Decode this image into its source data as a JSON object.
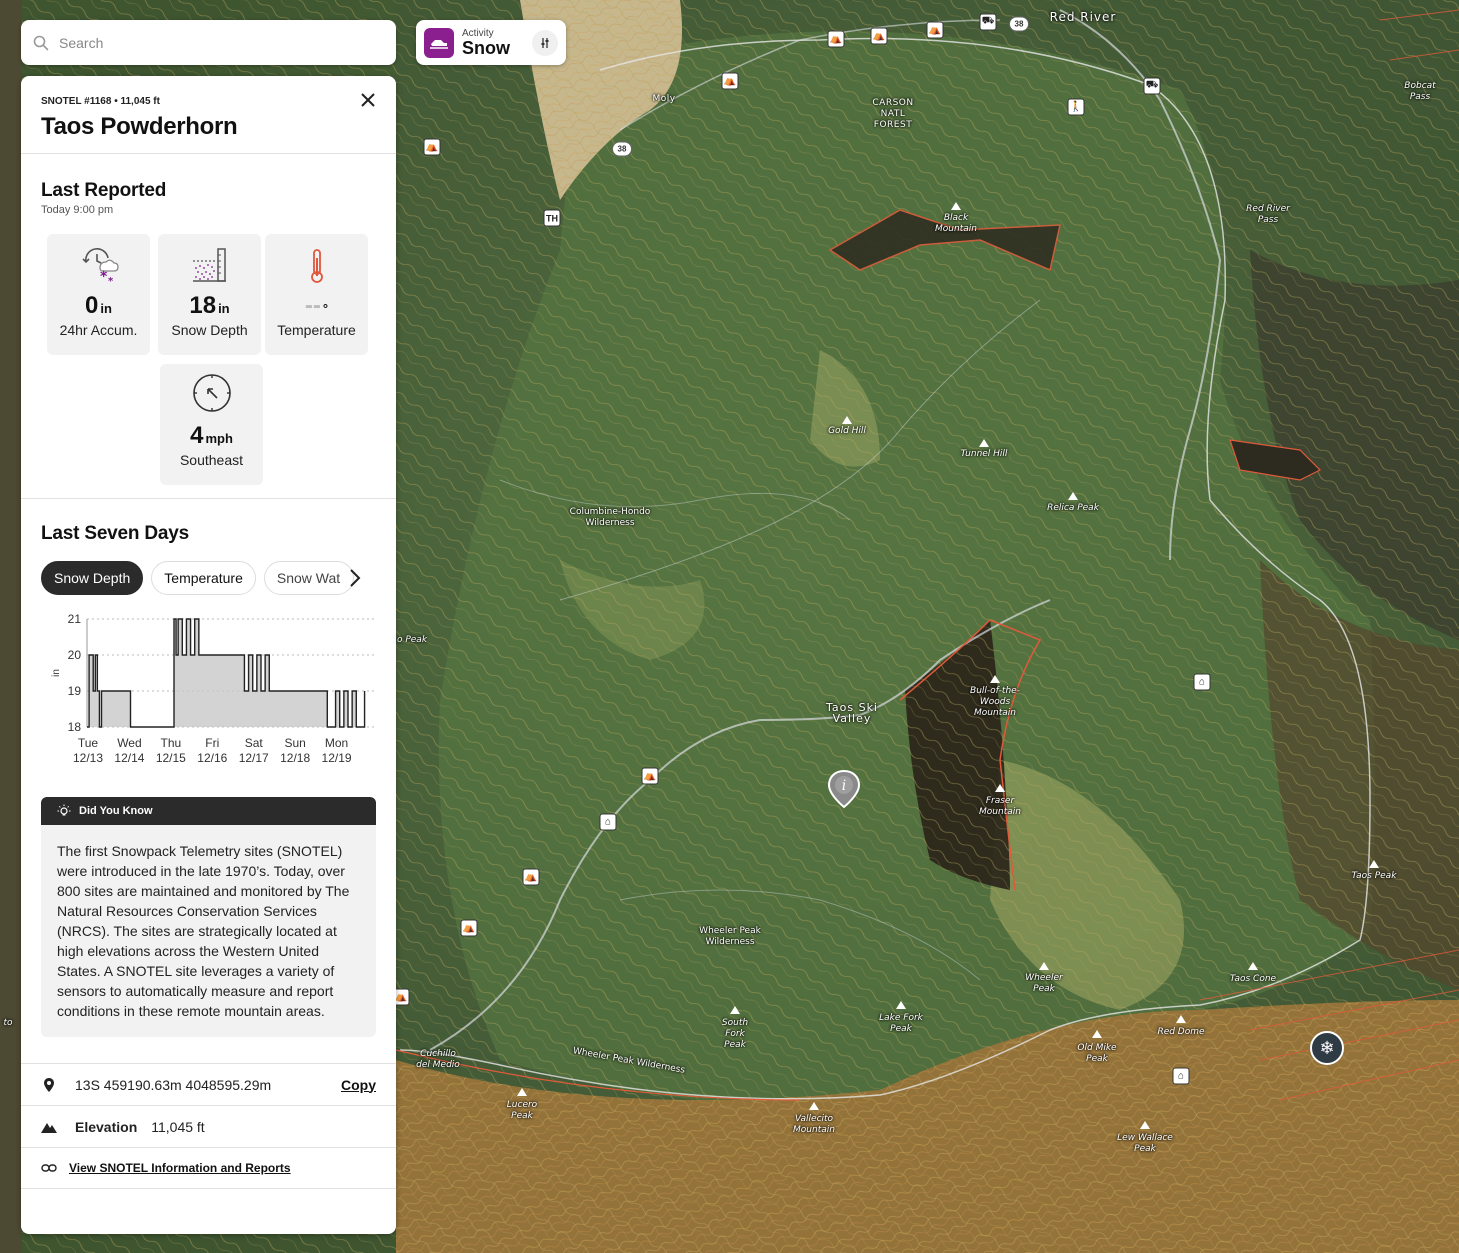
{
  "search": {
    "placeholder": "Search"
  },
  "activity": {
    "kicker": "Activity",
    "name": "Snow"
  },
  "panel": {
    "meta": "SNOTEL #1168 • 11,045 ft",
    "title": "Taos Powderhorn",
    "last_reported": {
      "heading": "Last Reported",
      "time": "Today 9:00 pm",
      "tiles": [
        {
          "icon": "snowfall-accumulation-icon",
          "value": "0",
          "unit": "in",
          "label": "24hr Accum."
        },
        {
          "icon": "snow-depth-gauge-icon",
          "value": "18",
          "unit": "in",
          "label": "Snow Depth"
        },
        {
          "icon": "thermometer-icon",
          "value": "--",
          "unit": "°",
          "label": "Temperature"
        },
        {
          "icon": "wind-compass-icon",
          "value": "4",
          "unit": "mph",
          "label": "Southeast"
        }
      ]
    },
    "seven_days": {
      "heading": "Last Seven Days",
      "tabs": [
        "Snow Depth",
        "Temperature",
        "Snow Wat"
      ]
    },
    "did_you_know": {
      "heading": "Did You Know",
      "body": "The first Snowpack Telemetry sites (SNOTEL) were introduced in the late 1970’s. Today, over 800 sites are maintained and monitored by The Natural Resources Conservation Services (NRCS). The sites are strategically located at high elevations across the Western United States. A SNOTEL site leverages a variety of sensors to automatically measure and report conditions in these remote mountain areas."
    },
    "coords": "13S 459190.63m 4048595.29m",
    "copy_label": "Copy",
    "elevation_label": "Elevation",
    "elevation_value": "11,045 ft",
    "report_link": "View SNOTEL Information and Reports"
  },
  "chart_data": {
    "type": "line",
    "ylabel": "in",
    "ylim": [
      18,
      21
    ],
    "yticks": [
      18,
      19,
      20,
      21
    ],
    "xticks": [
      {
        "day": "Tue",
        "date": "12/13"
      },
      {
        "day": "Wed",
        "date": "12/14"
      },
      {
        "day": "Thu",
        "date": "12/15"
      },
      {
        "day": "Fri",
        "date": "12/16"
      },
      {
        "day": "Sat",
        "date": "12/17"
      },
      {
        "day": "Sun",
        "date": "12/18"
      },
      {
        "day": "Mon",
        "date": "12/19"
      }
    ],
    "series": [
      {
        "fill": true,
        "x": [
          0,
          0.05,
          0.1,
          0.15,
          0.2,
          0.25,
          0.3,
          0.35,
          0.4,
          0.5,
          0.6,
          0.7,
          0.8,
          0.9,
          1.0,
          1.05,
          1.1,
          1.2,
          1.3,
          1.4,
          1.5,
          1.6,
          1.7,
          1.8,
          1.9,
          2.0,
          2.1,
          2.15,
          2.2,
          2.3,
          2.4,
          2.5,
          2.6,
          2.7,
          2.8,
          2.9,
          3.0,
          3.1,
          3.2,
          3.3,
          3.4,
          3.5,
          3.6,
          3.7,
          3.8,
          3.9,
          4.0,
          4.1,
          4.2,
          4.3,
          4.4,
          4.5,
          4.6,
          4.7,
          4.8,
          4.9,
          5.0,
          5.1,
          5.2,
          5.3,
          5.4,
          5.5,
          5.6,
          5.7,
          5.8,
          5.9,
          6.0,
          6.1,
          6.2,
          6.3,
          6.4,
          6.5,
          6.6,
          6.7
        ],
        "y": [
          18,
          20,
          20,
          19,
          20,
          19,
          18,
          19,
          19,
          19,
          19,
          19,
          19,
          19,
          19,
          18,
          18,
          18,
          18,
          18,
          18,
          18,
          18,
          18,
          18,
          18,
          21,
          20,
          21,
          20,
          21,
          20,
          21,
          20,
          20,
          20,
          20,
          20,
          20,
          20,
          20,
          20,
          20,
          20,
          19,
          20,
          19,
          20,
          19,
          20,
          19,
          19,
          19,
          19,
          19,
          19,
          19,
          19,
          19,
          19,
          19,
          19,
          19,
          19,
          18,
          18,
          19,
          18,
          19,
          18,
          19,
          18,
          18,
          19
        ]
      }
    ]
  },
  "map_labels": {
    "towns": [
      "Red River",
      "Moly",
      "Taos Ski Valley"
    ],
    "forest": "CARSON NATL FOREST",
    "wilderness": [
      "Columbine-Hondo Wilderness",
      "Wheeler Peak Wilderness",
      "Wheeler Peak Wilderness"
    ],
    "peaks": [
      "Black Mountain",
      "Gold Hill",
      "Tunnel Hill",
      "Relica Peak",
      "Bull-of-the-Woods Mountain",
      "Fraser Mountain",
      "Taos Peak",
      "Taos Cone",
      "Wheeler Peak",
      "Lake Fork Peak",
      "South Fork Peak",
      "Old Mike Peak",
      "Red Dome",
      "Lew Wallace Peak",
      "Vallecito Mountain",
      "Lucero Peak",
      "Cuchillo del Medio",
      "Bobcat Pass",
      "Red River Pass",
      "o Peak",
      "to"
    ],
    "routes": [
      "38",
      "38"
    ],
    "trailhead": "TH"
  }
}
